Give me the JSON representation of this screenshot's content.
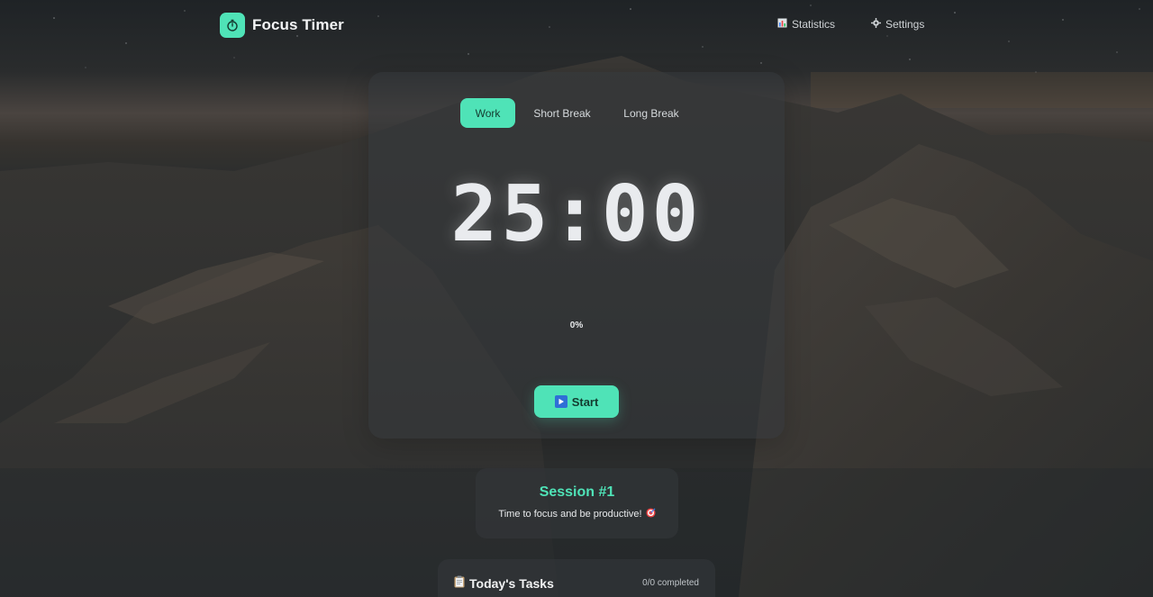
{
  "app": {
    "title": "Focus Timer",
    "logo_icon": "stopwatch-icon"
  },
  "nav": {
    "statistics": {
      "label": "Statistics",
      "icon": "bar-chart-icon"
    },
    "settings": {
      "label": "Settings",
      "icon": "gear-icon"
    }
  },
  "timer": {
    "tabs": [
      {
        "label": "Work",
        "active": true
      },
      {
        "label": "Short Break",
        "active": false
      },
      {
        "label": "Long Break",
        "active": false
      }
    ],
    "time": "25:00",
    "progress_text": "0%",
    "progress": 0,
    "start_label": "Start",
    "start_icon": "play-icon"
  },
  "session": {
    "title": "Session #1",
    "message": "Time to focus and be productive!",
    "message_icon": "target-icon"
  },
  "tasks": {
    "title": "Today's Tasks",
    "title_icon": "clipboard-icon",
    "count": "0/0 completed"
  },
  "colors": {
    "accent": "#4fe3b7",
    "background": "#23272a",
    "card": "#34383c"
  }
}
